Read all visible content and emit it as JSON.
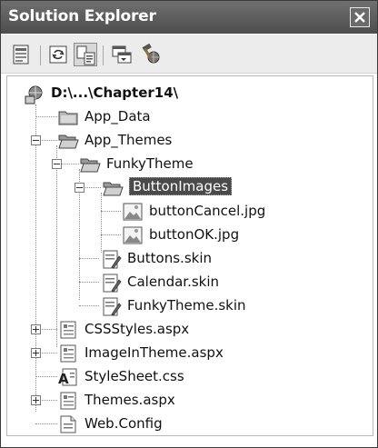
{
  "window": {
    "title": "Solution Explorer"
  },
  "toolbar": {
    "buttons": [
      {
        "name": "properties"
      },
      {
        "name": "refresh"
      },
      {
        "name": "nest-related-files",
        "pressed": true
      },
      {
        "name": "view-designer"
      },
      {
        "name": "asp-net-configuration"
      }
    ]
  },
  "tree": {
    "root": "D:\\...\\Chapter14\\",
    "items": [
      {
        "label": "App_Data",
        "icon": "folder"
      },
      {
        "label": "App_Themes",
        "icon": "folder-open",
        "expander": "minus"
      },
      {
        "label": "FunkyTheme",
        "icon": "folder-open",
        "expander": "minus"
      },
      {
        "label": "ButtonImages",
        "icon": "folder-open",
        "expander": "minus",
        "selected": true
      },
      {
        "label": "buttonCancel.jpg",
        "icon": "image"
      },
      {
        "label": "buttonOK.jpg",
        "icon": "image"
      },
      {
        "label": "Buttons.skin",
        "icon": "skin"
      },
      {
        "label": "Calendar.skin",
        "icon": "skin"
      },
      {
        "label": "FunkyTheme.skin",
        "icon": "skin"
      },
      {
        "label": "CSSStyles.aspx",
        "icon": "aspx",
        "expander": "plus"
      },
      {
        "label": "ImageInTheme.aspx",
        "icon": "aspx",
        "expander": "plus"
      },
      {
        "label": "StyleSheet.css",
        "icon": "css"
      },
      {
        "label": "Themes.aspx",
        "icon": "aspx",
        "expander": "plus"
      },
      {
        "label": "Web.Config",
        "icon": "config"
      }
    ]
  }
}
